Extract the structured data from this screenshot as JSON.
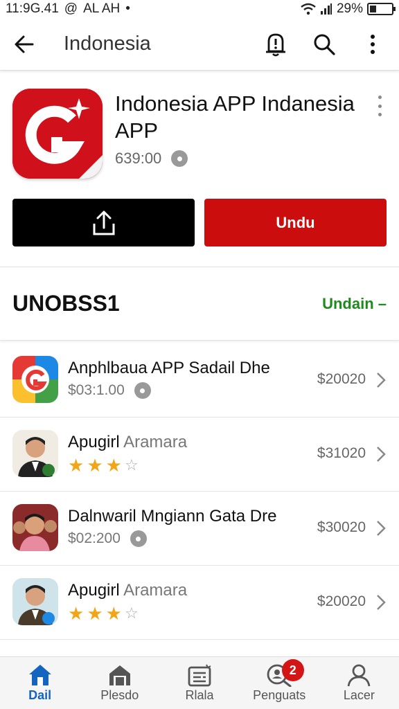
{
  "status_bar": {
    "time": "11:9G.41",
    "carrier": "AL AH",
    "battery_percent": "29%",
    "battery_level": 0.29
  },
  "app_bar": {
    "title": "Indonesia"
  },
  "hero": {
    "name": "Indonesia APP Indanesia APP",
    "meta": "639:00",
    "share_icon": "share-icon",
    "primary_label": "Undu",
    "brand_color": "#cc0d0d"
  },
  "section": {
    "title": "UNOBSS1",
    "link": "Undain –",
    "link_color": "#1e8a1e"
  },
  "list": [
    {
      "title": "Anphlbaua APP Sadail Dhe",
      "subtitle": "",
      "meta": "$03:1.00",
      "rating": null,
      "price": "$20020",
      "icon": "google-style-app-icon"
    },
    {
      "title": "Apugirl",
      "subtitle": "Aramara",
      "meta": "",
      "rating": 3,
      "price": "$31020",
      "icon": "man-avatar-icon"
    },
    {
      "title": "Dalnwaril Mngiann Gata Dre",
      "subtitle": "",
      "meta": "$02:200",
      "rating": null,
      "price": "$30020",
      "icon": "group-photo-icon"
    },
    {
      "title": "Apugirl",
      "subtitle": "Aramara",
      "meta": "",
      "rating": 3,
      "price": "$20020",
      "icon": "man-avatar-icon"
    }
  ],
  "bottom_nav": [
    {
      "label": "Dail",
      "icon": "home-icon",
      "active": true
    },
    {
      "label": "Plesdo",
      "icon": "store-icon",
      "active": false
    },
    {
      "label": "Rlala",
      "icon": "news-icon",
      "active": false
    },
    {
      "label": "Penguats",
      "icon": "search-user-icon",
      "active": false,
      "badge": "2"
    },
    {
      "label": "Lacer",
      "icon": "profile-icon",
      "active": false
    }
  ]
}
